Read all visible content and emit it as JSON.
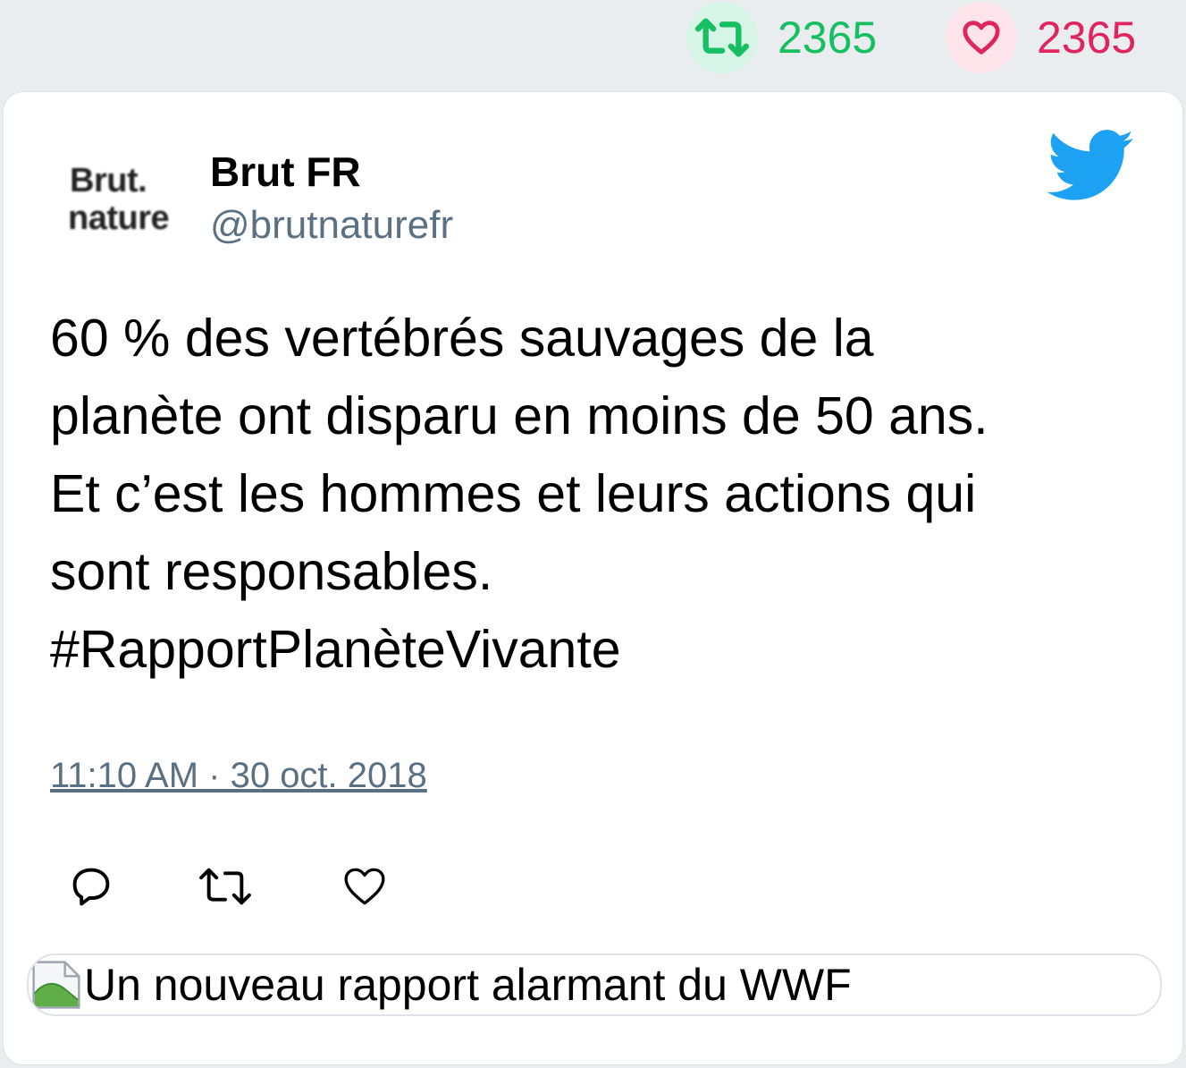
{
  "stats": {
    "retweets": "2365",
    "likes": "2365",
    "retweet_color": "#17bf63",
    "like_color": "#e0245e"
  },
  "tweet": {
    "avatar_line1": "Brut.",
    "avatar_line2": "nature",
    "author_name": "Brut FR",
    "handle": "@brutnaturefr",
    "text": "60 % des vertébrés sauvages de la\nplanète ont disparu en moins de 50 ans.\nEt c’est les hommes et leurs actions qui\nsont responsables.\n#RapportPlanèteVivante",
    "timestamp": "11:10 AM · 30 oct. 2018",
    "brand_icon": "twitter-bird-icon",
    "brand_color": "#1da1f2"
  },
  "actions": [
    "reply-icon",
    "retweet-icon",
    "like-icon"
  ],
  "link_card": {
    "title": "Un nouveau rapport alarmant du WWF",
    "thumb_icon": "broken-image-icon"
  }
}
